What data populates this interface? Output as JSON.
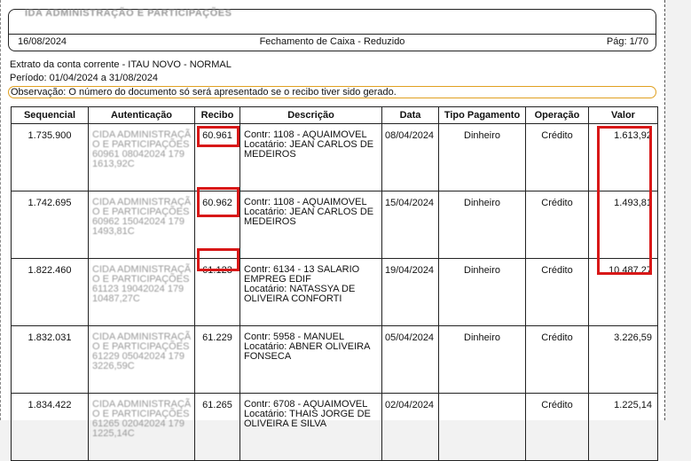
{
  "header": {
    "company": "IDA ADMINISTRAÇÃO E PARTICIPAÇÕES",
    "date": "16/08/2024",
    "title": "Fechamento de Caixa - Reduzido",
    "page": "Pág: 1/70"
  },
  "info": {
    "statement": "Extrato da conta corrente - ITAU NOVO - NORMAL",
    "period": "Período: 01/04/2024 a 31/08/2024",
    "observation": "Observação: O número do documento só será apresentado se o recibo tiver sido gerado."
  },
  "table": {
    "columns": [
      "Sequencial",
      "Autenticação",
      "Recibo",
      "Descrição",
      "Data",
      "Tipo Pagamento",
      "Operação",
      "Valor"
    ],
    "rows": [
      {
        "seq": "1.735.900",
        "auth1": "CIDA ADMINISTRAÇÃO E PARTICIPAÇÕES",
        "auth2": "60961 08042024 179 1613,92C",
        "recibo": "60.961",
        "desc1": "Contr: 1108 - AQUAIMOVEL",
        "desc2": "Locatário: JEAN CARLOS DE",
        "desc3": "MEDEIROS",
        "data": "08/04/2024",
        "tipo": "Dinheiro",
        "op": "Crédito",
        "valor": "1.613,92"
      },
      {
        "seq": "1.742.695",
        "auth1": "CIDA ADMINISTRAÇÃO E PARTICIPAÇÕES",
        "auth2": "60962 15042024 179 1493,81C",
        "recibo": "60.962",
        "desc1": "Contr: 1108 - AQUAIMOVEL",
        "desc2": "Locatário: JEAN CARLOS DE",
        "desc3": "MEDEIROS",
        "data": "15/04/2024",
        "tipo": "Dinheiro",
        "op": "Crédito",
        "valor": "1.493,81"
      },
      {
        "seq": "1.822.460",
        "auth1": "CIDA ADMINISTRAÇÃO E PARTICIPAÇÕES",
        "auth2": "61123 19042024 179 10487,27C",
        "recibo": "61.123",
        "desc1": "Contr: 6134 - 13 SALARIO",
        "desc2": "EMPREG EDIF",
        "desc3": "Locatário: NATASSYA DE OLIVEIRA CONFORTI",
        "data": "19/04/2024",
        "tipo": "Dinheiro",
        "op": "Crédito",
        "valor": "10.487,27"
      },
      {
        "seq": "1.832.031",
        "auth1": "CIDA ADMINISTRAÇÃO E PARTICIPAÇÕES",
        "auth2": "61229 05042024 179 3226,59C",
        "recibo": "61.229",
        "desc1": "Contr: 5958 - MANUEL",
        "desc2": "Locatário: ABNER OLIVEIRA",
        "desc3": "FONSECA",
        "data": "05/04/2024",
        "tipo": "Dinheiro",
        "op": "Crédito",
        "valor": "3.226,59"
      },
      {
        "seq": "1.834.422",
        "auth1": "CIDA ADMINISTRAÇÃO E PARTICIPAÇÕES",
        "auth2": "61265 02042024 179 1225,14C",
        "recibo": "61.265",
        "desc1": "Contr: 6708 - AQUAIMOVEL",
        "desc2": "Locatário: THAIS JORGE DE",
        "desc3": "OLIVEIRA E SILVA",
        "data": "02/04/2024",
        "tipo": "",
        "op": "Crédito",
        "valor": "1.225,14"
      }
    ]
  },
  "highlight_color": "#d81818"
}
